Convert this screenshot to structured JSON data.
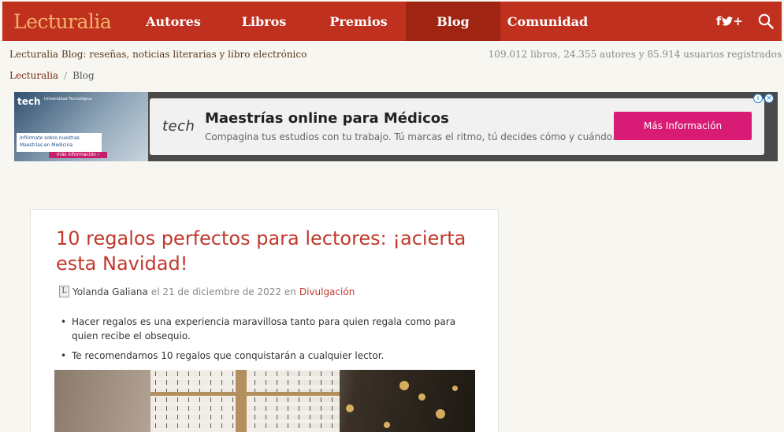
{
  "nav": {
    "logo": "Lecturalia",
    "items": [
      {
        "label": "Autores",
        "active": false
      },
      {
        "label": "Libros",
        "active": false
      },
      {
        "label": "Premios",
        "active": false
      },
      {
        "label": "Blog",
        "active": true
      },
      {
        "label": "Comunidad",
        "active": false
      }
    ],
    "social_label": "f🐦+",
    "icons": [
      "facebook-icon",
      "twitter-icon",
      "googleplus-icon",
      "search-icon"
    ]
  },
  "subheader": {
    "tagline": "Lecturalia Blog: reseñas, noticias literarias y libro electrónico",
    "stats": "109.012 libros, 24.355 autores y 85.914 usuarios registrados"
  },
  "breadcrumb": {
    "home": "Lecturalia",
    "separator": "/",
    "current": "Blog"
  },
  "ad": {
    "brand": "tech",
    "brand_sub": "Universidad Tecnológica",
    "left_info": "Infórmate sobre nuestras Maestrías en Medicina",
    "left_button": "más información ›",
    "title": "Maestrías online para Médicos",
    "description": "Compagina tus estudios con tu trabajo. Tú marcas el ritmo, tú decides cómo y cuándo.",
    "button": "Más Información",
    "choices_info": "i",
    "choices_close": "×"
  },
  "article": {
    "title": "10 regalos perfectos para lectores: ¡acierta esta Navidad!",
    "author_icon_letter": "L",
    "author": "Yolanda Galiana",
    "date_text": "el 21 de diciembre de 2022 en",
    "category": "Divulgación",
    "bullets": [
      "Hacer regalos es una experiencia maravillosa tanto para quien regala como para quien recibe el obsequio.",
      "Te recomendamos 10 regalos que conquistarán a cualquier lector."
    ]
  },
  "colors": {
    "brand_red": "#c0301f",
    "active_nav": "#9f2412",
    "logo_orange": "#f2b26a",
    "ad_button": "#d81b75"
  }
}
